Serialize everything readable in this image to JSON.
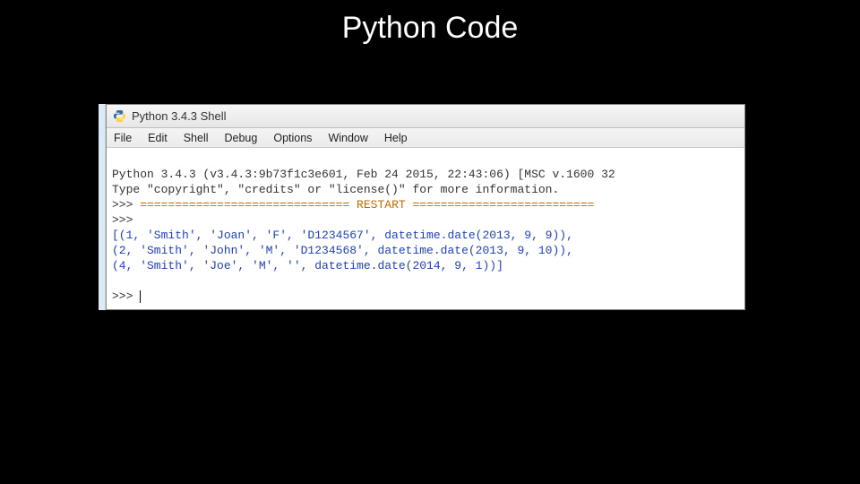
{
  "slide": {
    "title": "Python Code"
  },
  "window": {
    "title": "Python 3.4.3 Shell"
  },
  "menu": {
    "items": [
      "File",
      "Edit",
      "Shell",
      "Debug",
      "Options",
      "Window",
      "Help"
    ]
  },
  "console": {
    "line1": "Python 3.4.3 (v3.4.3:9b73f1c3e601, Feb 24 2015, 22:43:06) [MSC v.1600 32",
    "line2": "Type \"copyright\", \"credits\" or \"license()\" for more information.",
    "prompt": ">>> ",
    "restart": "============================== RESTART ==========================",
    "out1": "[(1, 'Smith', 'Joan', 'F', 'D1234567', datetime.date(2013, 9, 9)),",
    "out2": "(2, 'Smith', 'John', 'M', 'D1234568', datetime.date(2013, 9, 10)),",
    "out3": "(4, 'Smith', 'Joe', 'M', '', datetime.date(2014, 9, 1))]"
  }
}
